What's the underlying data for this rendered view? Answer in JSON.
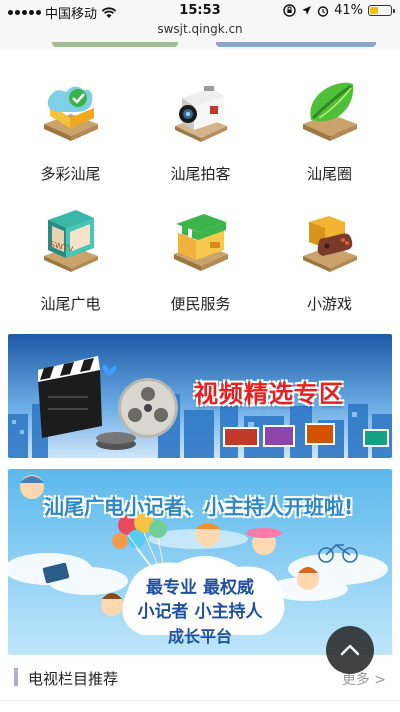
{
  "status_bar": {
    "carrier": "中国移动",
    "time": "15:53",
    "battery_percent": "41%",
    "battery_level": 0.41,
    "icons": [
      "signal-icon",
      "wifi-icon",
      "lock-rotation-icon",
      "location-icon",
      "alarm-icon",
      "battery-icon"
    ]
  },
  "address_bar": {
    "url": "swsjt.qingk.cn"
  },
  "grid": {
    "items": [
      {
        "label": "多彩汕尾",
        "icon": "colorful-shanwei-icon"
      },
      {
        "label": "汕尾拍客",
        "icon": "camera-icon"
      },
      {
        "label": "汕尾圈",
        "icon": "leaf-circle-icon"
      },
      {
        "label": "汕尾广电",
        "icon": "tv-icon"
      },
      {
        "label": "便民服务",
        "icon": "store-icon"
      },
      {
        "label": "小游戏",
        "icon": "game-controller-icon"
      }
    ]
  },
  "banners": {
    "video": {
      "title": "视频精选专区"
    },
    "reporter": {
      "title": "汕尾广电小记者、小主持人开班啦!",
      "line1": "最专业 最权威",
      "line2": "小记者 小主持人",
      "line3": "成长平台"
    }
  },
  "section": {
    "title": "电视栏目推荐",
    "more": "更多 >"
  },
  "colors": {
    "accent_red": "#e8201f",
    "accent_blue": "#2d86c8",
    "section_bar": "#aab2cf"
  }
}
